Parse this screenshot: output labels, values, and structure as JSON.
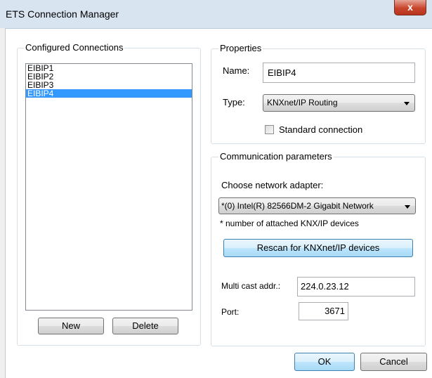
{
  "window": {
    "title": "ETS Connection Manager",
    "close_glyph": "x"
  },
  "connections": {
    "group_label": "Configured Connections",
    "items": [
      {
        "label": "EIBIP1",
        "selected": false
      },
      {
        "label": "EIBIP2",
        "selected": false
      },
      {
        "label": "EIBIP3",
        "selected": false
      },
      {
        "label": "EIBIP4",
        "selected": true
      }
    ],
    "new_label": "New",
    "delete_label": "Delete"
  },
  "properties": {
    "group_label": "Properties",
    "name_label": "Name:",
    "name_value": "EIBIP4",
    "type_label": "Type:",
    "type_value": "KNXnet/IP Routing",
    "standard_label": "Standard connection",
    "standard_checked": false
  },
  "comm": {
    "group_label": "Communication parameters",
    "adapter_label": "Choose network adapter:",
    "adapter_value": "*(0) Intel(R) 82566DM-2 Gigabit Network",
    "note": "* number of attached KNX/IP devices",
    "rescan_label": "Rescan for KNXnet/IP devices",
    "multicast_label": "Multi cast addr.:",
    "multicast_value": "224.0.23.12",
    "port_label": "Port:",
    "port_value": "3671"
  },
  "footer": {
    "ok_label": "OK",
    "cancel_label": "Cancel"
  },
  "colors": {
    "selection": "#3399ff",
    "close_red": "#c8452c",
    "default_blue": "#3c7fb1"
  }
}
